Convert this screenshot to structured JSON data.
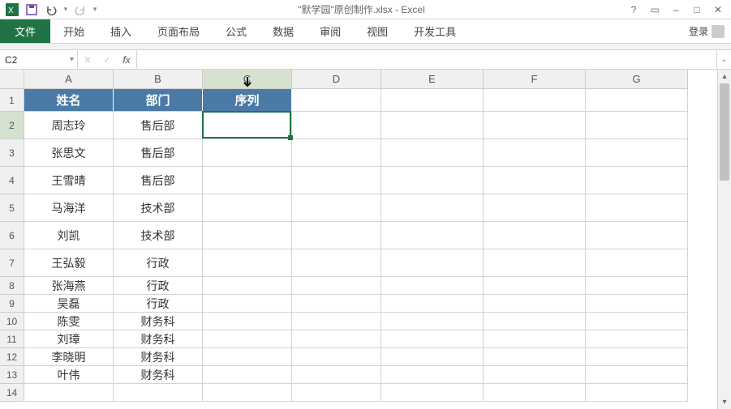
{
  "titlebar": {
    "title": "\"默学园\"原创制作.xlsx - Excel"
  },
  "win_controls": {
    "help": "?",
    "ribbon_opts": "▭",
    "min": "–",
    "max": "□",
    "close": "✕"
  },
  "ribbon": {
    "file": "文件",
    "tabs": [
      "开始",
      "插入",
      "页面布局",
      "公式",
      "数据",
      "审阅",
      "视图",
      "开发工具"
    ],
    "login": "登录"
  },
  "formula_bar": {
    "name_box": "C2",
    "cancel": "✕",
    "enter": "✓",
    "fx": "fx",
    "formula": ""
  },
  "columns": [
    {
      "letter": "A",
      "width": 110
    },
    {
      "letter": "B",
      "width": 110
    },
    {
      "letter": "C",
      "width": 110
    },
    {
      "letter": "D",
      "width": 110
    },
    {
      "letter": "E",
      "width": 126
    },
    {
      "letter": "F",
      "width": 126
    },
    {
      "letter": "G",
      "width": 126
    }
  ],
  "row_heights": {
    "r1": 28,
    "r2": 34,
    "r3": 34,
    "r4": 34,
    "r5": 34,
    "r6": 34,
    "r7": 34,
    "r8": 22,
    "r9": 22,
    "r10": 22,
    "r11": 22,
    "r12": 22,
    "r13": 22,
    "r14": 22
  },
  "active_cell": {
    "col": "C",
    "row": 2
  },
  "header_row": {
    "A": "姓名",
    "B": "部门",
    "C": "序列"
  },
  "data_rows": [
    {
      "A": "周志玲",
      "B": "售后部"
    },
    {
      "A": "张思文",
      "B": "售后部"
    },
    {
      "A": "王雪晴",
      "B": "售后部"
    },
    {
      "A": "马海洋",
      "B": "技术部"
    },
    {
      "A": "刘凯",
      "B": "技术部"
    },
    {
      "A": "王弘毅",
      "B": "行政"
    },
    {
      "A": "张海燕",
      "B": "行政"
    },
    {
      "A": "吴磊",
      "B": "行政"
    },
    {
      "A": "陈雯",
      "B": "财务科"
    },
    {
      "A": "刘璋",
      "B": "财务科"
    },
    {
      "A": "李晓明",
      "B": "财务科"
    },
    {
      "A": "叶伟",
      "B": "财务科"
    }
  ],
  "colors": {
    "excel_green": "#217346",
    "header_blue": "#4a7aa5"
  }
}
